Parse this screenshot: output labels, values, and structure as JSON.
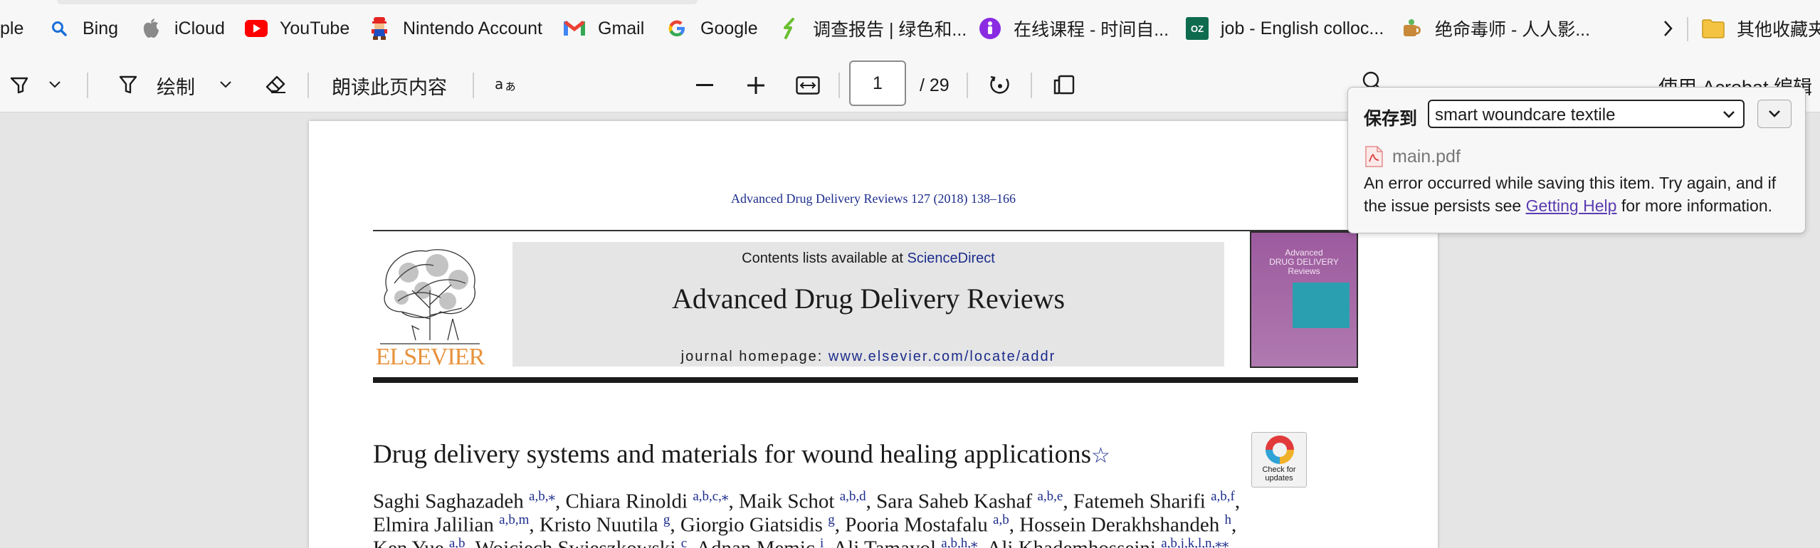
{
  "bookmarks": [
    {
      "label": "ple",
      "icon": "apple-icon"
    },
    {
      "label": "Bing",
      "icon": "search-icon"
    },
    {
      "label": "iCloud",
      "icon": "apple-icon"
    },
    {
      "label": "YouTube",
      "icon": "youtube-icon"
    },
    {
      "label": "Nintendo Account",
      "icon": "mario-icon"
    },
    {
      "label": "Gmail",
      "icon": "gmail-icon"
    },
    {
      "label": "Google",
      "icon": "google-icon"
    },
    {
      "label": "调查报告 | 绿色和...",
      "icon": "greenpeace-icon"
    },
    {
      "label": "在线课程 - 时间自...",
      "icon": "course-icon"
    },
    {
      "label": "job - English colloc...",
      "icon": "oz-icon"
    },
    {
      "label": "绝命毒师 - 人人影...",
      "icon": "cup-icon"
    },
    {
      "label": "其他收藏夹",
      "icon": "folder-icon"
    }
  ],
  "toolbar": {
    "draw_label": "绘制",
    "read_aloud_label": "朗读此页内容",
    "page_current": "1",
    "page_total": "/ 29",
    "acrobat_label": "使用 Acrobat 编辑"
  },
  "pdf": {
    "citation": "Advanced Drug Delivery Reviews 127 (2018) 138–166",
    "contents_prefix": "Contents lists available at",
    "contents_link": "ScienceDirect",
    "journal_title": "Advanced Drug Delivery Reviews",
    "homepage_prefix": "journal homepage:",
    "homepage_url": "www.elsevier.com/locate/addr",
    "publisher": "ELSEVIER",
    "cover_title": "Advanced\nDRUG DELIVERY\nReviews",
    "check_updates": "Check for updates",
    "article_title": "Drug delivery systems and materials for wound healing applications",
    "authors_line1": [
      {
        "name": "Saghi Saghazadeh ",
        "aff": "a,b,⁎"
      },
      {
        "name": ", Chiara Rinoldi ",
        "aff": "a,b,c,⁎"
      },
      {
        "name": ", Maik Schot ",
        "aff": "a,b,d"
      },
      {
        "name": ", Sara Saheb Kashaf ",
        "aff": "a,b,e"
      },
      {
        "name": ", Fatemeh Sharifi ",
        "aff": "a,b,f"
      },
      {
        "name": ",",
        "aff": ""
      }
    ],
    "authors_line2": [
      {
        "name": "Elmira Jalilian ",
        "aff": "a,b,m"
      },
      {
        "name": ", Kristo Nuutila ",
        "aff": "g"
      },
      {
        "name": ", Giorgio Giatsidis ",
        "aff": "g"
      },
      {
        "name": ", Pooria Mostafalu ",
        "aff": "a,b"
      },
      {
        "name": ", Hossein Derakhshandeh ",
        "aff": "h"
      },
      {
        "name": ",",
        "aff": ""
      }
    ],
    "authors_line3": [
      {
        "name": "Ken Yue ",
        "aff": "a,b"
      },
      {
        "name": ", Wojciech Swieszkowski ",
        "aff": "c"
      },
      {
        "name": ", Adnan Memic ",
        "aff": "i"
      },
      {
        "name": ", Ali Tamayol ",
        "aff": "a,b,h,⁎"
      },
      {
        "name": ", Ali Khademhosseini ",
        "aff": "a,b,j,k,l,n,⁎⁎"
      }
    ]
  },
  "popup": {
    "save_to_label": "保存到",
    "collection_value": "smart woundcare textile",
    "item_name": "main.pdf",
    "error_prefix": "An error occurred while saving this item. Try again, and if the issue persists see",
    "error_link": "Getting Help",
    "error_suffix": "for more information."
  },
  "colors": {
    "link_blue": "#1c2c8c",
    "elsevier_orange": "#e8923c",
    "popup_link": "#5a3cb0"
  }
}
